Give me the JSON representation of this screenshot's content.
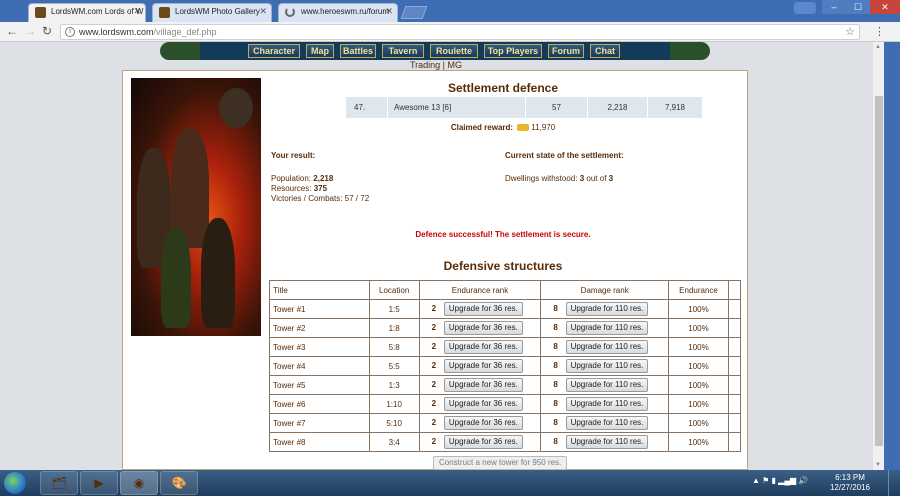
{
  "browser": {
    "tabs": [
      {
        "title": "LordsWM.com Lords of W"
      },
      {
        "title": "LordsWM Photo Gallery"
      },
      {
        "title": "www.heroeswm.ru/forum"
      }
    ],
    "url_host": "www.lordswm.com",
    "url_path": "/village_def.php"
  },
  "game_nav": {
    "items": [
      "Character",
      "Map",
      "Battles",
      "Tavern",
      "Roulette",
      "Top Players",
      "Forum",
      "Chat"
    ],
    "sub": "Trading | MG"
  },
  "settlement": {
    "title": "Settlement defence",
    "rank_row": {
      "rank": "47.",
      "name": "Awesome 13 [6]",
      "level": "57",
      "population": "2,218",
      "score": "7,918"
    },
    "claimed_label": "Claimed reward:",
    "claimed_value": "11,970"
  },
  "your_result": {
    "heading": "Your result:",
    "population_label": "Population:",
    "population": "2,218",
    "resources_label": "Resources:",
    "resources": "375",
    "victories_label": "Victories / Combats:",
    "victories": "57 / 72"
  },
  "state": {
    "heading": "Current state of the settlement:",
    "dwellings_label": "Dwellings withstood:",
    "withstood": "3",
    "out_of": "out of",
    "total": "3"
  },
  "success_message": "Defence successful! The settlement is secure.",
  "defensive": {
    "title": "Defensive structures",
    "headers": [
      "Title",
      "Location",
      "Endurance rank",
      "Damage rank",
      "Endurance"
    ],
    "rows": [
      {
        "title": "Tower #1",
        "location": "1:5",
        "end_rank": "2",
        "end_btn": "Upgrade for 36 res.",
        "dmg_rank": "8",
        "dmg_btn": "Upgrade for 110 res.",
        "endurance": "100%"
      },
      {
        "title": "Tower #2",
        "location": "1:8",
        "end_rank": "2",
        "end_btn": "Upgrade for 36 res.",
        "dmg_rank": "8",
        "dmg_btn": "Upgrade for 110 res.",
        "endurance": "100%"
      },
      {
        "title": "Tower #3",
        "location": "5:8",
        "end_rank": "2",
        "end_btn": "Upgrade for 36 res.",
        "dmg_rank": "8",
        "dmg_btn": "Upgrade for 110 res.",
        "endurance": "100%"
      },
      {
        "title": "Tower #4",
        "location": "5:5",
        "end_rank": "2",
        "end_btn": "Upgrade for 36 res.",
        "dmg_rank": "8",
        "dmg_btn": "Upgrade for 110 res.",
        "endurance": "100%"
      },
      {
        "title": "Tower #5",
        "location": "1:3",
        "end_rank": "2",
        "end_btn": "Upgrade for 36 res.",
        "dmg_rank": "8",
        "dmg_btn": "Upgrade for 110 res.",
        "endurance": "100%"
      },
      {
        "title": "Tower #6",
        "location": "1:10",
        "end_rank": "2",
        "end_btn": "Upgrade for 36 res.",
        "dmg_rank": "8",
        "dmg_btn": "Upgrade for 110 res.",
        "endurance": "100%"
      },
      {
        "title": "Tower #7",
        "location": "5:10",
        "end_rank": "2",
        "end_btn": "Upgrade for 36 res.",
        "dmg_rank": "8",
        "dmg_btn": "Upgrade for 110 res.",
        "endurance": "100%"
      },
      {
        "title": "Tower #8",
        "location": "3:4",
        "end_rank": "2",
        "end_btn": "Upgrade for 36 res.",
        "dmg_rank": "8",
        "dmg_btn": "Upgrade for 110 res.",
        "endurance": "100%"
      }
    ],
    "build_button": "Construct a new tower for 950 res."
  },
  "taskbar": {
    "time": "6:13 PM",
    "date": "12/27/2016"
  },
  "colors": {
    "text_brown": "#592c08",
    "success_red": "#c8000a",
    "nav_blue": "#143a5a",
    "nav_gold": "#f3e08a",
    "browser_blue": "#3e6db3"
  },
  "icons": {
    "back": "arrow-left-icon",
    "forward": "arrow-right-icon",
    "reload": "reload-icon",
    "star": "star-icon",
    "menu": "kebab-menu-icon",
    "gold": "gold-icon"
  }
}
